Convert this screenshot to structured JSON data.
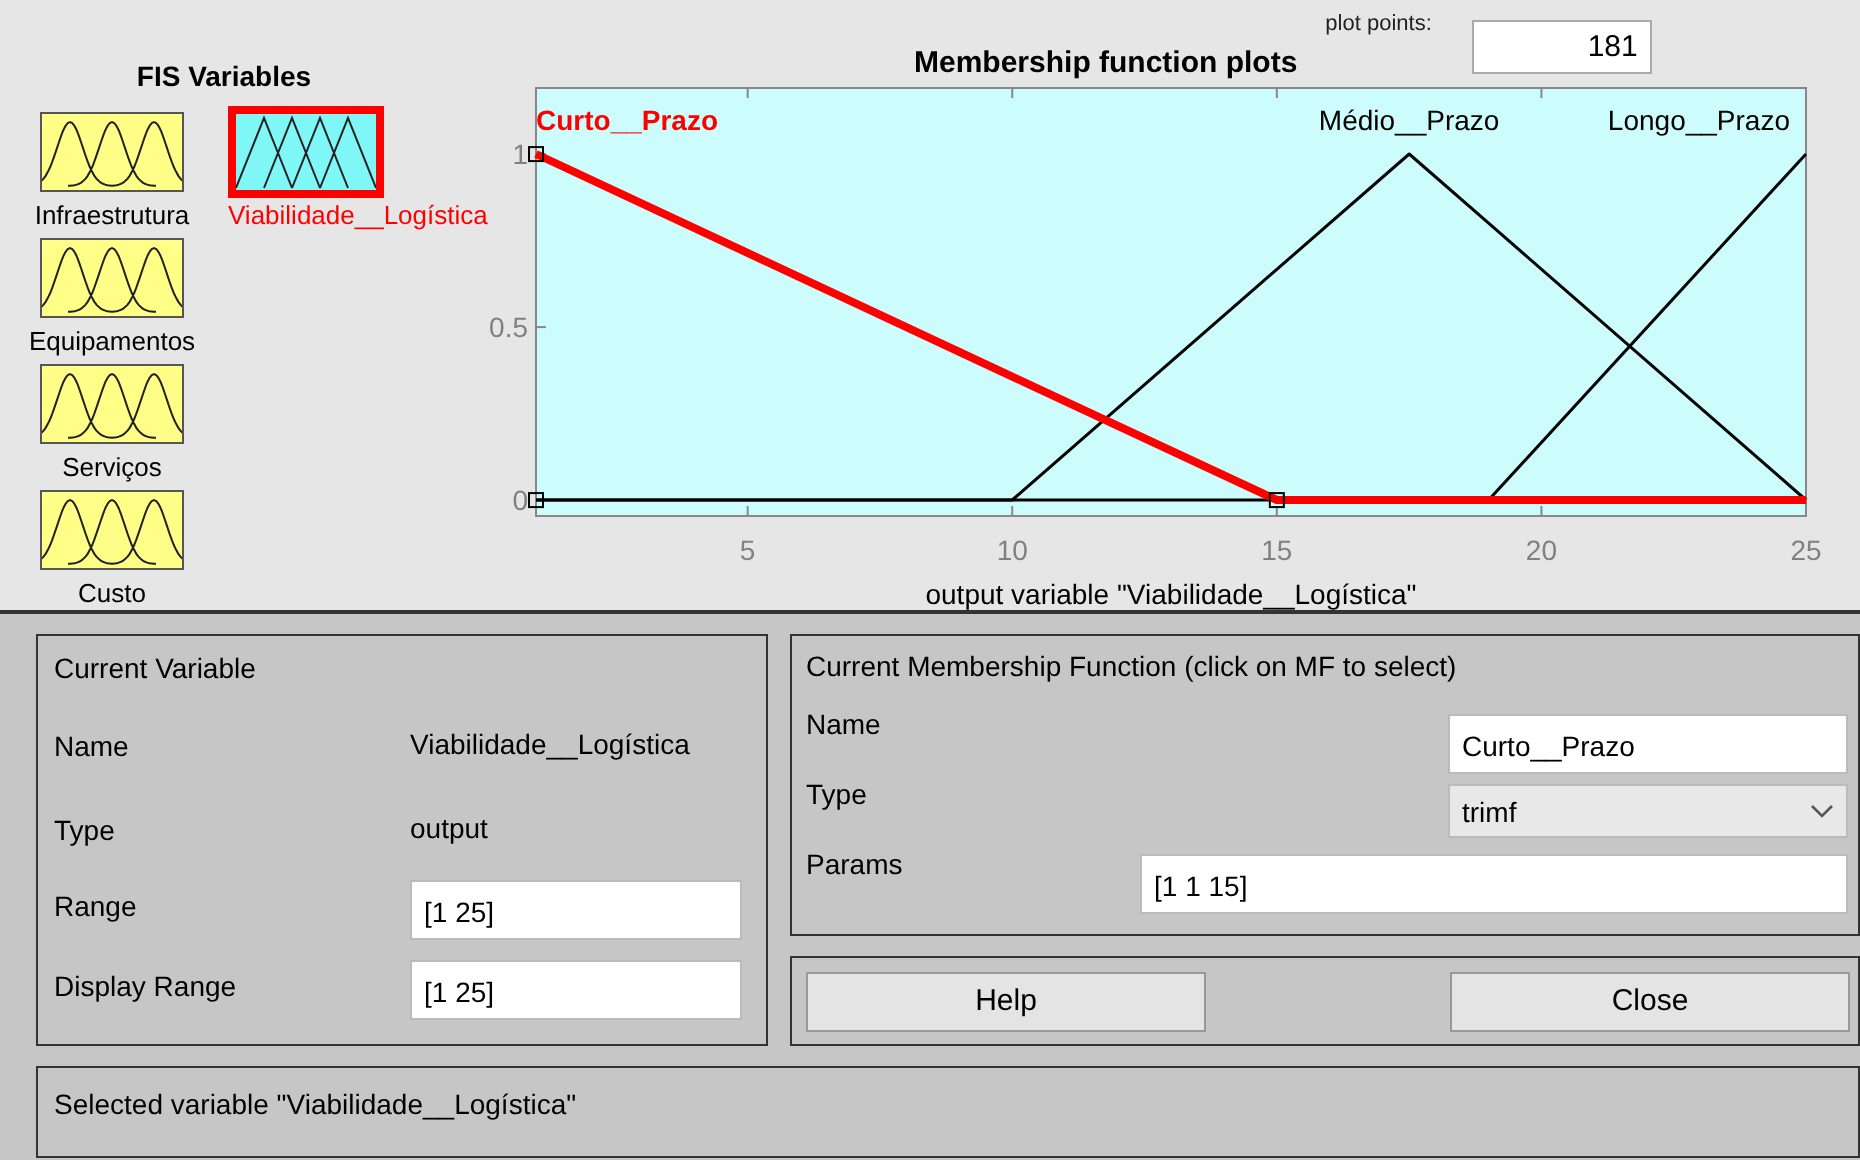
{
  "fis_variables": {
    "title": "FIS Variables",
    "items": [
      {
        "label": "Infraestrutura",
        "kind": "input",
        "selected": false
      },
      {
        "label": "Viabilidade__Logística",
        "kind": "output",
        "selected": true
      },
      {
        "label": "Equipamentos",
        "kind": "input",
        "selected": false
      },
      {
        "label": "Serviços",
        "kind": "input",
        "selected": false
      },
      {
        "label": "Custo",
        "kind": "input",
        "selected": false
      }
    ]
  },
  "plot": {
    "title": "Membership function plots",
    "plot_points_label": "plot points:",
    "plot_points": "181",
    "membership_functions": [
      {
        "label": "Curto__Prazo",
        "selected": true
      },
      {
        "label": "Médio__Prazo",
        "selected": false
      },
      {
        "label": "Longo__Prazo",
        "selected": false
      }
    ],
    "chart_data": {
      "type": "line",
      "xlabel": "output variable \"Viabilidade__Logística\"",
      "x": [
        1,
        10,
        15,
        17.5,
        19,
        25
      ],
      "series": [
        {
          "color": "#ff0000",
          "values": [
            1,
            0.357,
            0,
            0,
            0,
            0
          ]
        },
        {
          "color": "#000000",
          "values": [
            0,
            0,
            0.667,
            1,
            0.8,
            0
          ]
        },
        {
          "color": "#000000",
          "values": [
            0,
            0,
            0,
            0,
            0,
            1
          ]
        }
      ],
      "xlim": [
        1,
        25
      ],
      "ylim": [
        -0.046,
        1.191
      ],
      "xticks": [
        5,
        10,
        15,
        20,
        25
      ],
      "yticks": [
        0,
        0.5,
        1
      ]
    }
  },
  "current_variable": {
    "title": "Current Variable",
    "name_label": "Name",
    "name": "Viabilidade__Logística",
    "type_label": "Type",
    "type": "output",
    "range_label": "Range",
    "range": "[1 25]",
    "display_range_label": "Display Range",
    "display_range": "[1 25]"
  },
  "current_mf": {
    "title": "Current Membership Function (click on MF to select)",
    "name_label": "Name",
    "name": "Curto__Prazo",
    "type_label": "Type",
    "type": "trimf",
    "params_label": "Params",
    "params": "[1 1 15]"
  },
  "buttons": [
    "Help",
    "Close"
  ],
  "status": "Selected variable \"Viabilidade__Logística\""
}
